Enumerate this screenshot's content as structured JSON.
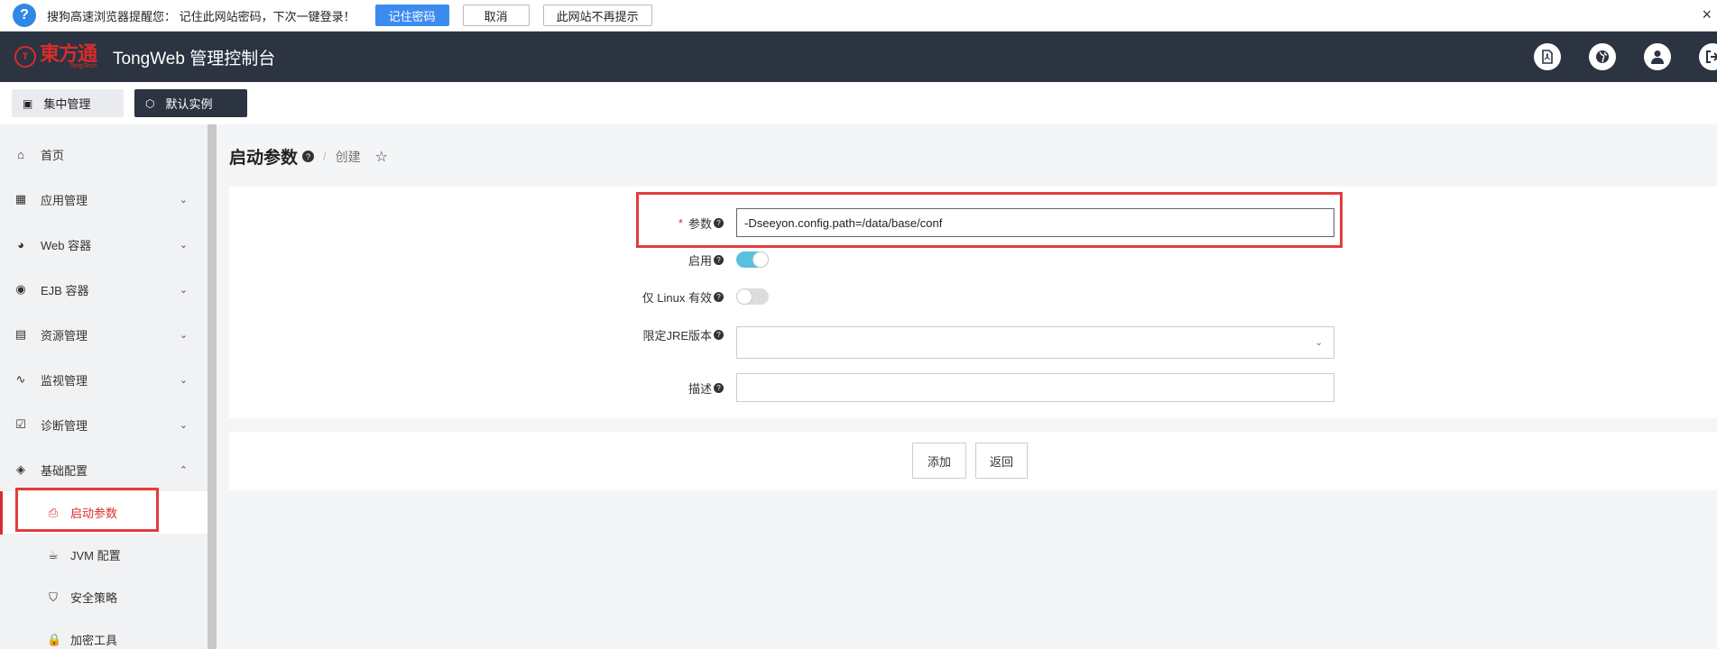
{
  "password_bar": {
    "message": "搜狗高速浏览器提醒您： 记住此网站密码，下次一键登录！",
    "remember_button": "记住密码",
    "cancel_button": "取消",
    "never_button": "此网站不再提示",
    "close": "×"
  },
  "header": {
    "logo_text": "東方通",
    "logo_sub": "TongTech",
    "logo_seal": "T",
    "title": "TongWeb 管理控制台",
    "icons": [
      "pdf-icon",
      "globe-icon",
      "user-icon",
      "logout-icon"
    ]
  },
  "tabs": [
    {
      "label": "集中管理",
      "icon": "▣"
    },
    {
      "label": "默认实例",
      "icon": "⬡"
    }
  ],
  "sidebar": {
    "items": [
      {
        "label": "首页",
        "icon": "⌂"
      },
      {
        "label": "应用管理",
        "icon": "▦"
      },
      {
        "label": "Web 容器",
        "icon": "◕"
      },
      {
        "label": "EJB 容器",
        "icon": "◉"
      },
      {
        "label": "资源管理",
        "icon": "▤"
      },
      {
        "label": "监视管理",
        "icon": "∿"
      },
      {
        "label": "诊断管理",
        "icon": "☑"
      },
      {
        "label": "基础配置",
        "icon": "◈"
      }
    ],
    "sub_items": [
      {
        "label": "启动参数",
        "icon": "⎙"
      },
      {
        "label": "JVM 配置",
        "icon": "☕"
      },
      {
        "label": "安全策略",
        "icon": "⛉"
      },
      {
        "label": "加密工具",
        "icon": "🔒"
      }
    ]
  },
  "breadcrumb": {
    "title": "启动参数",
    "current": "创建",
    "separator": "/"
  },
  "form": {
    "param_label": "参数",
    "param_value": "-Dseeyon.config.path=/data/base/conf",
    "enabled_label": "启用",
    "enabled": true,
    "linux_label": "仅 Linux 有效",
    "linux_only": false,
    "jre_label": "限定JRE版本",
    "jre_value": "",
    "desc_label": "描述",
    "desc_value": ""
  },
  "buttons": {
    "add": "添加",
    "back": "返回"
  }
}
